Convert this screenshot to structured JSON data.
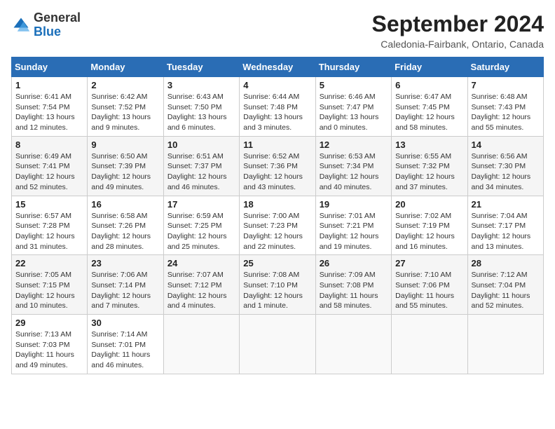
{
  "header": {
    "logo_general": "General",
    "logo_blue": "Blue",
    "title": "September 2024",
    "subtitle": "Caledonia-Fairbank, Ontario, Canada"
  },
  "weekdays": [
    "Sunday",
    "Monday",
    "Tuesday",
    "Wednesday",
    "Thursday",
    "Friday",
    "Saturday"
  ],
  "weeks": [
    [
      {
        "day": "1",
        "sunrise": "Sunrise: 6:41 AM",
        "sunset": "Sunset: 7:54 PM",
        "daylight": "Daylight: 13 hours and 12 minutes."
      },
      {
        "day": "2",
        "sunrise": "Sunrise: 6:42 AM",
        "sunset": "Sunset: 7:52 PM",
        "daylight": "Daylight: 13 hours and 9 minutes."
      },
      {
        "day": "3",
        "sunrise": "Sunrise: 6:43 AM",
        "sunset": "Sunset: 7:50 PM",
        "daylight": "Daylight: 13 hours and 6 minutes."
      },
      {
        "day": "4",
        "sunrise": "Sunrise: 6:44 AM",
        "sunset": "Sunset: 7:48 PM",
        "daylight": "Daylight: 13 hours and 3 minutes."
      },
      {
        "day": "5",
        "sunrise": "Sunrise: 6:46 AM",
        "sunset": "Sunset: 7:47 PM",
        "daylight": "Daylight: 13 hours and 0 minutes."
      },
      {
        "day": "6",
        "sunrise": "Sunrise: 6:47 AM",
        "sunset": "Sunset: 7:45 PM",
        "daylight": "Daylight: 12 hours and 58 minutes."
      },
      {
        "day": "7",
        "sunrise": "Sunrise: 6:48 AM",
        "sunset": "Sunset: 7:43 PM",
        "daylight": "Daylight: 12 hours and 55 minutes."
      }
    ],
    [
      {
        "day": "8",
        "sunrise": "Sunrise: 6:49 AM",
        "sunset": "Sunset: 7:41 PM",
        "daylight": "Daylight: 12 hours and 52 minutes."
      },
      {
        "day": "9",
        "sunrise": "Sunrise: 6:50 AM",
        "sunset": "Sunset: 7:39 PM",
        "daylight": "Daylight: 12 hours and 49 minutes."
      },
      {
        "day": "10",
        "sunrise": "Sunrise: 6:51 AM",
        "sunset": "Sunset: 7:37 PM",
        "daylight": "Daylight: 12 hours and 46 minutes."
      },
      {
        "day": "11",
        "sunrise": "Sunrise: 6:52 AM",
        "sunset": "Sunset: 7:36 PM",
        "daylight": "Daylight: 12 hours and 43 minutes."
      },
      {
        "day": "12",
        "sunrise": "Sunrise: 6:53 AM",
        "sunset": "Sunset: 7:34 PM",
        "daylight": "Daylight: 12 hours and 40 minutes."
      },
      {
        "day": "13",
        "sunrise": "Sunrise: 6:55 AM",
        "sunset": "Sunset: 7:32 PM",
        "daylight": "Daylight: 12 hours and 37 minutes."
      },
      {
        "day": "14",
        "sunrise": "Sunrise: 6:56 AM",
        "sunset": "Sunset: 7:30 PM",
        "daylight": "Daylight: 12 hours and 34 minutes."
      }
    ],
    [
      {
        "day": "15",
        "sunrise": "Sunrise: 6:57 AM",
        "sunset": "Sunset: 7:28 PM",
        "daylight": "Daylight: 12 hours and 31 minutes."
      },
      {
        "day": "16",
        "sunrise": "Sunrise: 6:58 AM",
        "sunset": "Sunset: 7:26 PM",
        "daylight": "Daylight: 12 hours and 28 minutes."
      },
      {
        "day": "17",
        "sunrise": "Sunrise: 6:59 AM",
        "sunset": "Sunset: 7:25 PM",
        "daylight": "Daylight: 12 hours and 25 minutes."
      },
      {
        "day": "18",
        "sunrise": "Sunrise: 7:00 AM",
        "sunset": "Sunset: 7:23 PM",
        "daylight": "Daylight: 12 hours and 22 minutes."
      },
      {
        "day": "19",
        "sunrise": "Sunrise: 7:01 AM",
        "sunset": "Sunset: 7:21 PM",
        "daylight": "Daylight: 12 hours and 19 minutes."
      },
      {
        "day": "20",
        "sunrise": "Sunrise: 7:02 AM",
        "sunset": "Sunset: 7:19 PM",
        "daylight": "Daylight: 12 hours and 16 minutes."
      },
      {
        "day": "21",
        "sunrise": "Sunrise: 7:04 AM",
        "sunset": "Sunset: 7:17 PM",
        "daylight": "Daylight: 12 hours and 13 minutes."
      }
    ],
    [
      {
        "day": "22",
        "sunrise": "Sunrise: 7:05 AM",
        "sunset": "Sunset: 7:15 PM",
        "daylight": "Daylight: 12 hours and 10 minutes."
      },
      {
        "day": "23",
        "sunrise": "Sunrise: 7:06 AM",
        "sunset": "Sunset: 7:14 PM",
        "daylight": "Daylight: 12 hours and 7 minutes."
      },
      {
        "day": "24",
        "sunrise": "Sunrise: 7:07 AM",
        "sunset": "Sunset: 7:12 PM",
        "daylight": "Daylight: 12 hours and 4 minutes."
      },
      {
        "day": "25",
        "sunrise": "Sunrise: 7:08 AM",
        "sunset": "Sunset: 7:10 PM",
        "daylight": "Daylight: 12 hours and 1 minute."
      },
      {
        "day": "26",
        "sunrise": "Sunrise: 7:09 AM",
        "sunset": "Sunset: 7:08 PM",
        "daylight": "Daylight: 11 hours and 58 minutes."
      },
      {
        "day": "27",
        "sunrise": "Sunrise: 7:10 AM",
        "sunset": "Sunset: 7:06 PM",
        "daylight": "Daylight: 11 hours and 55 minutes."
      },
      {
        "day": "28",
        "sunrise": "Sunrise: 7:12 AM",
        "sunset": "Sunset: 7:04 PM",
        "daylight": "Daylight: 11 hours and 52 minutes."
      }
    ],
    [
      {
        "day": "29",
        "sunrise": "Sunrise: 7:13 AM",
        "sunset": "Sunset: 7:03 PM",
        "daylight": "Daylight: 11 hours and 49 minutes."
      },
      {
        "day": "30",
        "sunrise": "Sunrise: 7:14 AM",
        "sunset": "Sunset: 7:01 PM",
        "daylight": "Daylight: 11 hours and 46 minutes."
      },
      null,
      null,
      null,
      null,
      null
    ]
  ]
}
